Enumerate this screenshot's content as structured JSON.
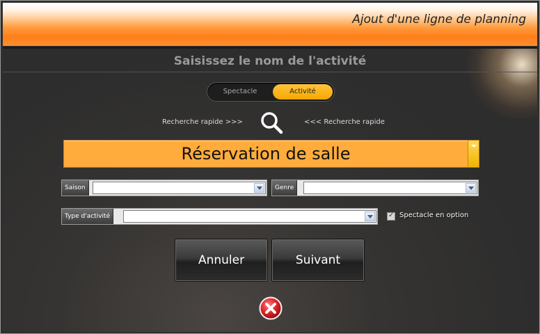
{
  "window": {
    "title": "Ajout d'une ligne de planning"
  },
  "page": {
    "title": "Saisissez le nom de l'activité"
  },
  "mode_toggle": {
    "options": [
      "Spectacle",
      "Activité"
    ],
    "selected": "Activité"
  },
  "quick_search": {
    "left_label": "Recherche rapide >>>",
    "right_label": "<<< Recherche rapide",
    "icon": "search-icon"
  },
  "activity": {
    "value": "Réservation de salle"
  },
  "fields": {
    "saison": {
      "label": "Saison",
      "value": ""
    },
    "genre": {
      "label": "Genre",
      "value": ""
    },
    "type_activite": {
      "label": "Type d'activité",
      "value": ""
    }
  },
  "option": {
    "label": "Spectacle en option",
    "checked": true
  },
  "buttons": {
    "cancel": "Annuler",
    "next": "Suivant"
  },
  "close": {
    "icon": "close-icon",
    "color": "#e0262a"
  },
  "colors": {
    "accent": "#ffac3c",
    "toggle_active": "#f6a800",
    "header_gradient": "#ff8c2e"
  }
}
